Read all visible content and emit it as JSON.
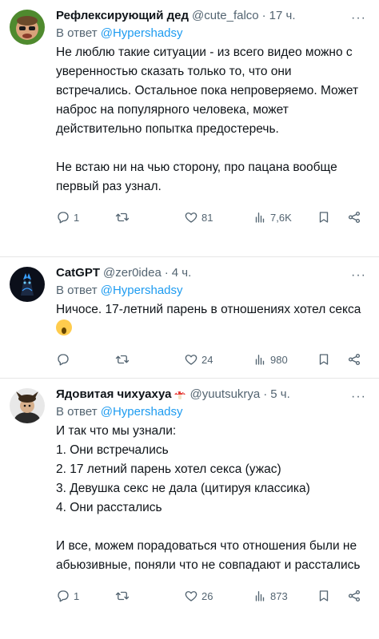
{
  "tweets": [
    {
      "name": "Рефлексирующий дед",
      "handle": "@cute_falco",
      "time": "17 ч.",
      "reply_prefix": "В ответ",
      "reply_to": "@Hypershadsy",
      "paragraphs": [
        "Не люблю такие ситуации - из всего видео можно с уверенностью сказать только то, что они встречались. Остальное пока непроверяемо. Может наброс на популярного человека, может действительно попытка предостеречь.",
        "Не встаю ни на чью сторону, про пацана вообще первый раз узнал."
      ],
      "replies": "1",
      "retweets": "",
      "likes": "81",
      "views": "7,6K"
    },
    {
      "name": "CatGPT",
      "handle": "@zer0idea",
      "time": "4 ч.",
      "reply_prefix": "В ответ",
      "reply_to": "@Hypershadsy",
      "text": "Ничосе. 17-летний парень в отношениях хотел секса",
      "replies": "",
      "retweets": "",
      "likes": "24",
      "views": "980"
    },
    {
      "name": "Ядовитая чихуахуа",
      "handle": "@yuutsukrya",
      "time": "5 ч.",
      "reply_prefix": "В ответ",
      "reply_to": "@Hypershadsy",
      "lines": [
        "И так что мы узнали:",
        "1. Они встречались",
        "2. 17 летний парень хотел секса (ужас)",
        "3. Девушка секс не дала (цитируя классика)",
        "4. Они расстались"
      ],
      "closing": "И все, можем порадоваться что отношения были не абьюзивные, поняли что не совпадают и расстались",
      "replies": "1",
      "retweets": "",
      "likes": "26",
      "views": "873"
    }
  ],
  "colors": {
    "text": "#0f1419",
    "secondary": "#536471",
    "link": "#1d9bf0",
    "divider": "#e6e6e6"
  },
  "icons": [
    "reply-icon",
    "retweet-icon",
    "like-icon",
    "views-icon",
    "bookmark-icon",
    "share-icon",
    "more-icon",
    "scream-emoji",
    "mushroom-emoji"
  ]
}
